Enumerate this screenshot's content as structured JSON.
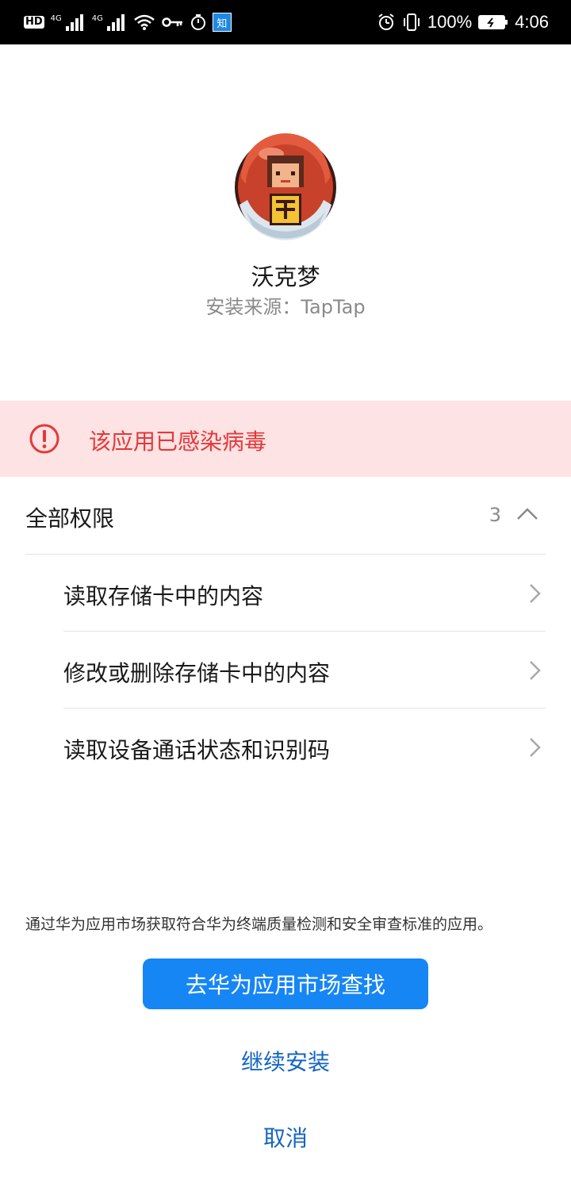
{
  "status_bar": {
    "hd": "HD",
    "net1": "4G",
    "net2": "4G",
    "zhihu_badge": "知",
    "battery": "100%",
    "time": "4:06",
    "icons": [
      "hd-icon",
      "signal-icon",
      "signal-icon",
      "wifi-icon",
      "key-icon",
      "timer-icon",
      "zhihu-app-icon",
      "alarm-icon",
      "vibrate-icon",
      "battery-icon"
    ]
  },
  "app": {
    "name": "沃克梦",
    "source": "安装来源：TapTap",
    "icon": "app-icon"
  },
  "warning": {
    "text": "该应用已感染病毒",
    "icon": "exclamation-circle-icon",
    "color": "#e5383b",
    "background": "#fde3e3"
  },
  "permissions": {
    "title": "全部权限",
    "count": "3",
    "toggle_icon": "chevron-up-icon",
    "items": [
      {
        "label": "读取存储卡中的内容"
      },
      {
        "label": "修改或删除存储卡中的内容"
      },
      {
        "label": "读取设备通话状态和识别码"
      }
    ]
  },
  "footer": {
    "note": "通过华为应用市场获取符合华为终端质量检测和安全审查标准的应用。",
    "primary_button": "去华为应用市场查找",
    "continue_button": "继续安装",
    "cancel_button": "取消",
    "accent": "#1686f5"
  }
}
